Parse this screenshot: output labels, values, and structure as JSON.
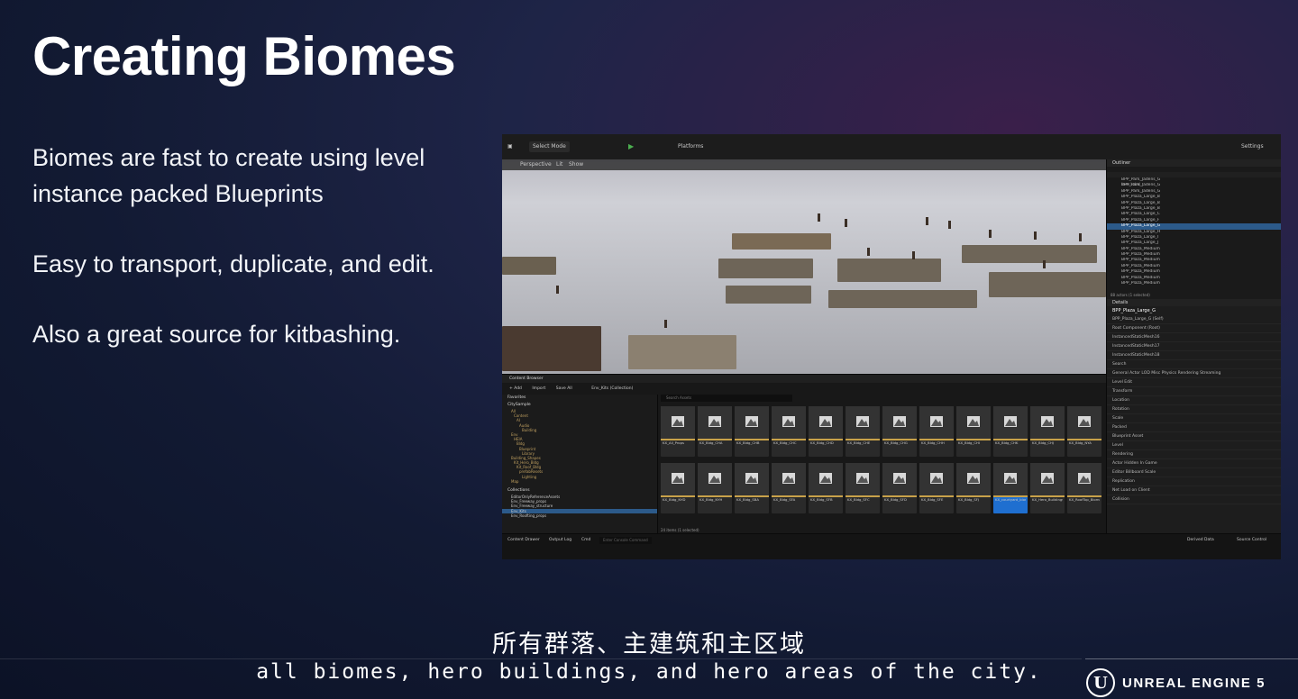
{
  "slide": {
    "title": "Creating Biomes",
    "bullets": [
      "Biomes are fast to create using level instance packed Blueprints",
      "Easy to transport, duplicate, and edit.",
      "Also a great source for kitbashing."
    ]
  },
  "editor": {
    "toolbar": {
      "select_mode": "Select Mode",
      "platforms": "Platforms",
      "settings": "Settings"
    },
    "viewport": {
      "perspective": "Perspective",
      "lit": "Lit",
      "show": "Show"
    },
    "outliner": {
      "title": "Outliner",
      "columns": [
        "Item Label",
        "Type",
        "Level",
        "Data Layer",
        "Package"
      ],
      "rows": [
        "BPP_Park_Jadens_G",
        "BPP_Park_Jadens_G",
        "BPP_Park_Jadens_G",
        "BPP_Plaza_Large_B",
        "BPP_Plaza_Large_B",
        "BPP_Plaza_Large_B",
        "BPP_Plaza_Large_C",
        "BPP_Plaza_Large_F",
        "BPP_Plaza_Large_G",
        "BPP_Plaza_Large_H",
        "BPP_Plaza_Large_I",
        "BPP_Plaza_Large_J",
        "BPP_Plaza_Medium",
        "BPP_Plaza_Medium",
        "BPP_Plaza_Medium",
        "BPP_Plaza_Medium",
        "BPP_Plaza_Medium",
        "BPP_Plaza_Medium",
        "BPP_Plaza_Medium"
      ],
      "selected_index": 8,
      "footer": "88 actors (1 selected)"
    },
    "details": {
      "title": "Details",
      "actor": "BPP_Plaza_Large_G",
      "add": "+ Add",
      "rows": [
        "BPP_Plaza_Large_G (Self)",
        "Root Component (Root)",
        "InstancedStaticMesh16",
        "InstancedStaticMesh17",
        "InstancedStaticMesh18",
        "Search",
        "General  Actor  LOD  Misc  Physics  Rendering  Streaming",
        "Level Edit",
        "Transform",
        "Location",
        "Rotation",
        "Scale",
        "Packed",
        "Blueprint Asset",
        "Level",
        "Rendering",
        "Actor Hidden In Game",
        "Editor Billboard Scale",
        "Replication",
        "Net Load on Client",
        "Collision"
      ]
    },
    "content_browser": {
      "title": "Content Browser",
      "buttons": [
        "+ Add",
        "Import",
        "Save All"
      ],
      "path": "Env_Kits (Collection)",
      "search_placeholder": "Search Assets",
      "filters": [
        "Blueprint Class",
        "Material Instance",
        "Redirector",
        "Static Mesh",
        "Level"
      ],
      "favorites": "Favorites",
      "root": "CitySample",
      "tree": [
        "All",
        "Content",
        "AI",
        "Audio",
        "Building",
        "Env",
        "HEIA",
        "Bldg",
        "Blueprint",
        "Library",
        "Building_Shapes",
        "Kit_Hero_Bldg",
        "Kit_Roof_Bldg",
        "prefabResets",
        "Lighting",
        "Map"
      ],
      "collections_title": "Collections",
      "collections": [
        "EditorOnlyReferenceAssets",
        "Env_Freeway_props",
        "Env_Freeway_structure",
        "Env_Kits",
        "Env_Roofting_props"
      ],
      "tiles": [
        "KX_All_Props",
        "KX_Bldg_CHA",
        "KX_Bldg_CHB",
        "KX_Bldg_CHC",
        "KX_Bldg_CHD",
        "KX_Bldg_CHE",
        "KX_Bldg_CHG",
        "KX_Bldg_CHH",
        "KX_Bldg_CHI",
        "KX_Bldg_CHK",
        "KX_Bldg_CHJ",
        "KX_Bldg_NYA",
        "KX_Bldg_NYD",
        "KX_Bldg_NYH",
        "KX_Bldg_SBA",
        "KX_Bldg_SFA",
        "KX_Bldg_SFB",
        "KX_Bldg_SFC",
        "KX_Bldg_SFD",
        "KX_Bldg_SFE",
        "KX_Bldg_SFJ",
        "KX_courtyard_biomes",
        "KX_Hero_Buildings",
        "KX_RoofTop_Biomes"
      ],
      "selected_tile": 21,
      "footer": "24 items (1 selected)"
    },
    "status": {
      "content_drawer": "Content Drawer",
      "output_log": "Output Log",
      "cmd": "Cmd",
      "console_placeholder": "Enter Console Command",
      "derived_data": "Derived Data",
      "source_control": "Source Control"
    }
  },
  "subtitles": {
    "zh": "所有群落、主建筑和主区域",
    "en": "all biomes, hero buildings, and hero areas of the city."
  },
  "brand": {
    "logo_text": "UNREAL ENGINE 5"
  }
}
